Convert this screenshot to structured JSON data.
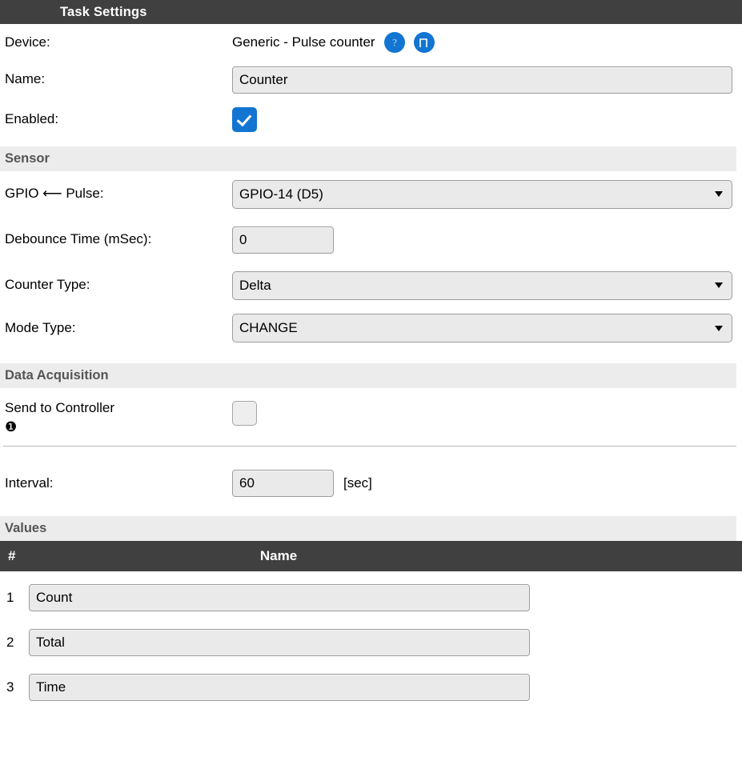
{
  "header": {
    "title": "Task Settings"
  },
  "device_row": {
    "label": "Device:",
    "value": "Generic - Pulse counter",
    "help_icon": "question-mark-icon",
    "pulse_icon": "pulse-waveform-icon"
  },
  "name_row": {
    "label": "Name:",
    "value": "Counter",
    "placeholder": ""
  },
  "enabled_row": {
    "label": "Enabled:",
    "checked": true
  },
  "sensor": {
    "section_title": "Sensor",
    "gpio": {
      "label": "GPIO ⟵ Pulse:",
      "value": "GPIO-14 (D5)"
    },
    "debounce": {
      "label": "Debounce Time (mSec):",
      "value": "0"
    },
    "counter_type": {
      "label": "Counter Type:",
      "value": "Delta"
    },
    "mode_type": {
      "label": "Mode Type:",
      "value": "CHANGE"
    }
  },
  "data_acquisition": {
    "section_title": "Data Acquisition",
    "send_to_controller": {
      "label": "Send to Controller",
      "index_badge": "❶",
      "checked": false
    },
    "interval": {
      "label": "Interval:",
      "value": "60",
      "unit": "[sec]"
    }
  },
  "values": {
    "section_title": "Values",
    "columns": {
      "number": "#",
      "name": "Name"
    },
    "rows": [
      {
        "number": "1",
        "name": "Count"
      },
      {
        "number": "2",
        "name": "Total"
      },
      {
        "number": "3",
        "name": "Time"
      }
    ]
  },
  "colors": {
    "header_bar": "#404040",
    "section_band": "#ececec",
    "accent_blue": "#1275d1",
    "input_bg": "#eaeaea",
    "input_border": "#9d9d9d"
  }
}
